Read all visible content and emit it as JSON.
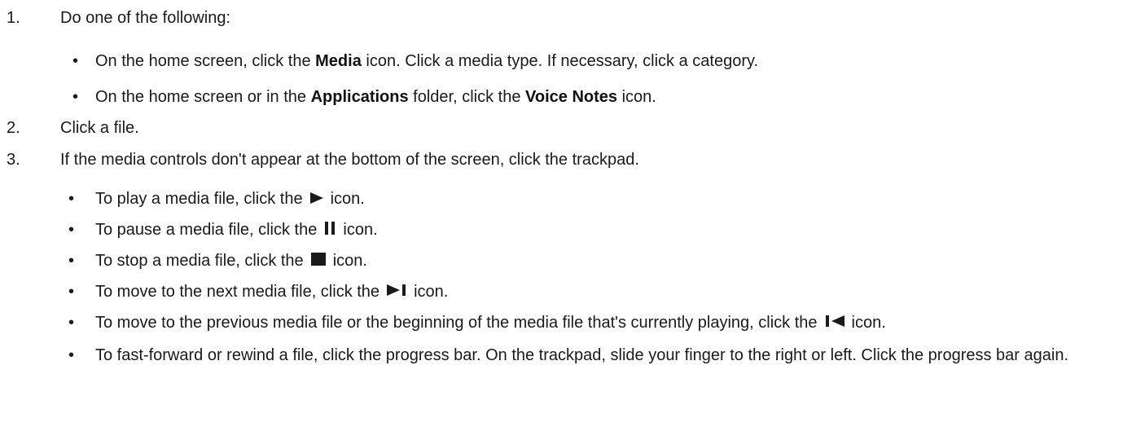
{
  "steps": [
    {
      "num": "1.",
      "text": "Do one of the following:"
    },
    {
      "num": "2.",
      "text": "Click a file."
    },
    {
      "num": "3.",
      "text": "If the media controls don't appear at the bottom of the screen, click the trackpad."
    }
  ],
  "step1_bullets": [
    {
      "pre": "On the home screen, click the ",
      "bold": "Media",
      "post": " icon. Click a media type. If necessary, click a category."
    },
    {
      "pre": "On the home screen or in the ",
      "bold": "Applications",
      "mid": " folder, click the ",
      "bold2": "Voice Notes",
      "post": " icon."
    }
  ],
  "step3_bullets": [
    {
      "pre": "To play a media file, click the",
      "icon": "play-icon",
      "post": "icon."
    },
    {
      "pre": "To pause a media file, click the",
      "icon": "pause-icon",
      "post": "icon."
    },
    {
      "pre": "To stop a media file, click the",
      "icon": "stop-icon",
      "post": "icon."
    },
    {
      "pre": "To move to the next media file, click the",
      "icon": "next-track-icon",
      "post": "icon."
    },
    {
      "pre": "To move to the previous media file or the beginning of the media file that's currently playing, click the",
      "icon": "previous-track-icon",
      "post": "icon."
    },
    {
      "pre": "To fast-forward or rewind a file, click the progress bar. On the trackpad, slide your finger to the right or left. Click the progress bar again."
    }
  ],
  "bullet_char": "•",
  "colors": {
    "text": "#1a1a1a",
    "icon": "#1a1a1a"
  }
}
